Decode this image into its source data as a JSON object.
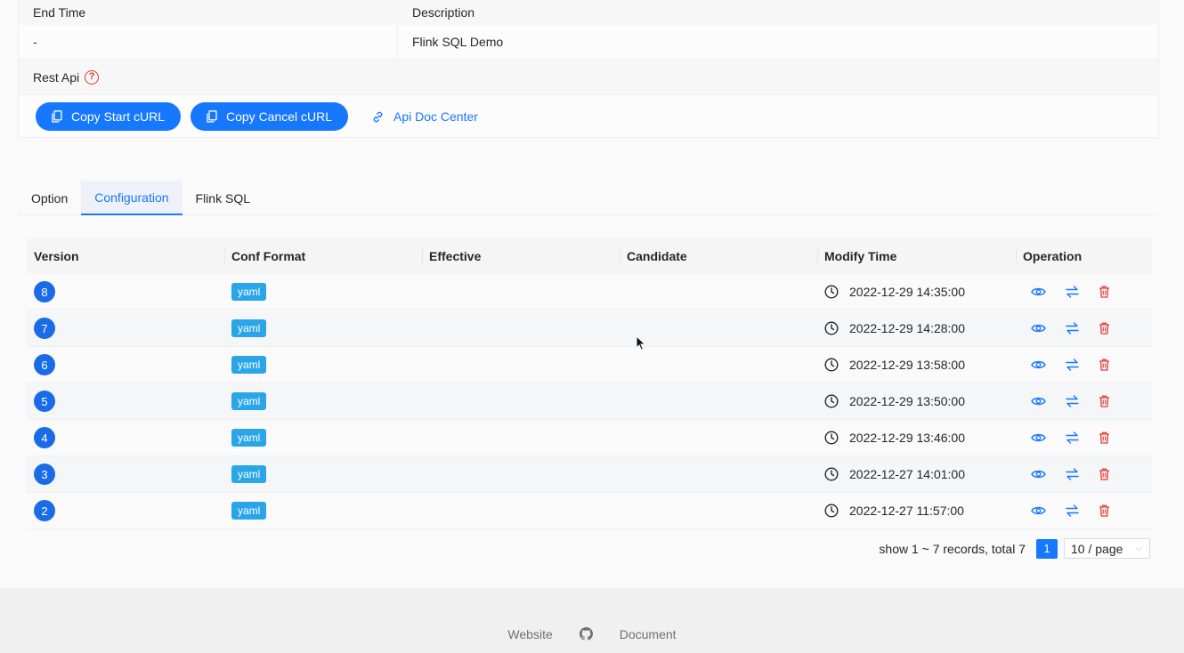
{
  "details": {
    "end_time_label": "End Time",
    "description_label": "Description",
    "end_time_value": "-",
    "description_value": "Flink SQL Demo",
    "rest_api_label": "Rest Api",
    "help_icon": "question-circle-icon"
  },
  "actions": {
    "copy_start": "Copy Start cURL",
    "copy_cancel": "Copy Cancel cURL",
    "api_doc": "Api Doc Center"
  },
  "tabs": [
    {
      "label": "Option"
    },
    {
      "label": "Configuration"
    },
    {
      "label": "Flink SQL"
    }
  ],
  "active_tab": "Configuration",
  "table": {
    "columns": [
      "Version",
      "Conf Format",
      "Effective",
      "Candidate",
      "Modify Time",
      "Operation"
    ],
    "rows": [
      {
        "version": "8",
        "format": "yaml",
        "time": "2022-12-29 14:35:00"
      },
      {
        "version": "7",
        "format": "yaml",
        "time": "2022-12-29 14:28:00"
      },
      {
        "version": "6",
        "format": "yaml",
        "time": "2022-12-29 13:58:00"
      },
      {
        "version": "5",
        "format": "yaml",
        "time": "2022-12-29 13:50:00"
      },
      {
        "version": "4",
        "format": "yaml",
        "time": "2022-12-29 13:46:00"
      },
      {
        "version": "3",
        "format": "yaml",
        "time": "2022-12-27 14:01:00"
      },
      {
        "version": "2",
        "format": "yaml",
        "time": "2022-12-27 11:57:00"
      }
    ]
  },
  "pagination": {
    "total_text": "show 1 ~ 7 records, total 7",
    "current_page": "1",
    "page_size": "10 / page"
  },
  "footer": {
    "website": "Website",
    "document": "Document"
  },
  "colors": {
    "primary": "#1677ff",
    "version_badge": "#1a6be6",
    "yaml_tag": "#2aa6e8",
    "delete": "#e53935"
  }
}
